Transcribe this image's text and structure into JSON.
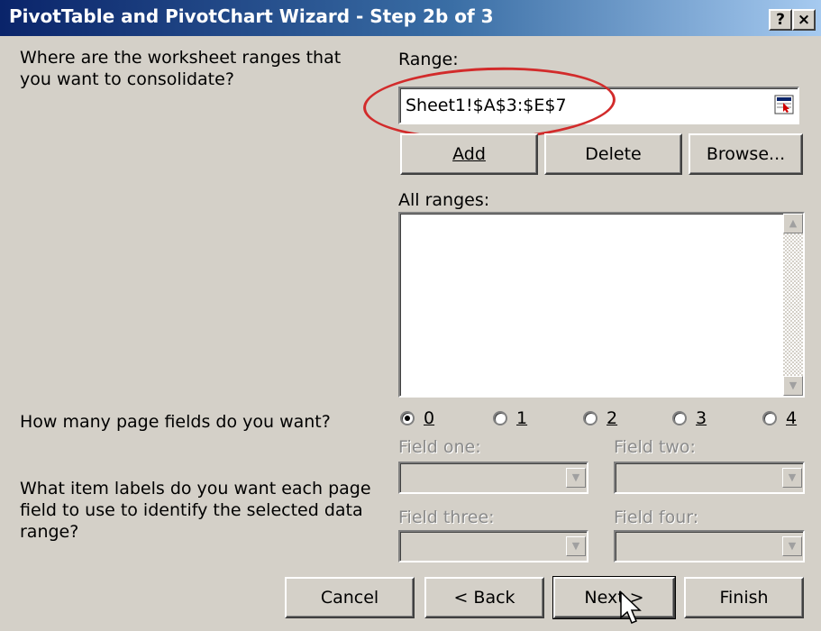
{
  "window": {
    "title": "PivotTable and PivotChart Wizard - Step 2b of 3",
    "help_glyph": "?",
    "close_glyph": "×"
  },
  "consolidate": {
    "question": "Where are the worksheet ranges that you want to consolidate?",
    "range_label": "Range:",
    "range_value": "Sheet1!$A$3:$E$7",
    "add_label": "Add",
    "delete_label": "Delete",
    "browse_label": "Browse...",
    "all_ranges_label": "All ranges:"
  },
  "page_fields": {
    "question": "How many page fields do you want?",
    "options": [
      "0",
      "1",
      "2",
      "3",
      "4"
    ],
    "selected": "0"
  },
  "item_labels": {
    "question": "What item labels do you want each page field to use to identify the selected data range?",
    "field_one_label": "Field one:",
    "field_two_label": "Field two:",
    "field_three_label": "Field three:",
    "field_four_label": "Field four:"
  },
  "footer": {
    "cancel_label": "Cancel",
    "back_label": "< Back",
    "next_label": "Next >",
    "finish_label": "Finish"
  },
  "icons": {
    "range_picker": "range-picker-icon",
    "dropdown": "chevron-down-icon",
    "scroll_up": "scroll-up-icon",
    "scroll_down": "scroll-down-icon",
    "cursor": "mouse-pointer-icon"
  },
  "colors": {
    "titlebar_start": "#0a246a",
    "titlebar_end": "#a6caf0",
    "dialog_bg": "#d4d0c8",
    "annotation": "#d22b2b"
  }
}
